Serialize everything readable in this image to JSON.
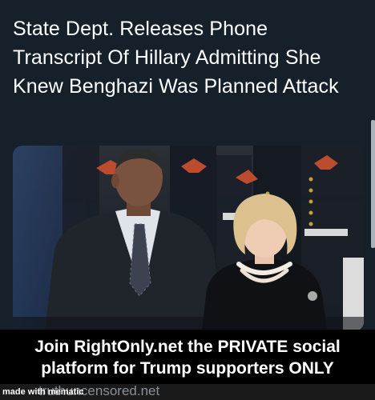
{
  "post": {
    "headline": "State Dept. Releases Phone Transcript Of Hillary Admitting She Knew Benghazi Was Planned Attack"
  },
  "photo": {
    "subject": "news-photo-man-and-woman-before-honor-guard"
  },
  "banner": {
    "text": "Join RightOnly.net the PRIVATE social platform for Trump supporters ONLY"
  },
  "footer": {
    "watermark": "made with mematic",
    "site_url": "truthuncensored.net"
  },
  "colors": {
    "background": "#15202b",
    "headline_text": "#ffffff",
    "banner_background": "#000000",
    "banner_text": "#ffffff",
    "site_url_text": "#8a8f94"
  }
}
